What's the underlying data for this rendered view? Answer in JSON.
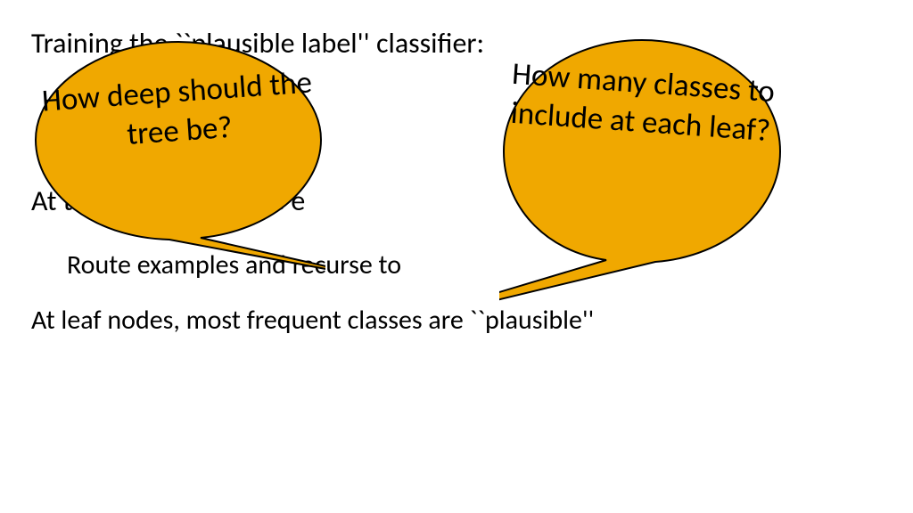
{
  "slide": {
    "lines": {
      "l1": "Training the ``plausible label'' classifier:",
      "l2": "At training time, solve e",
      "l3": "Route examples and recurse to",
      "l4": "At leaf nodes, most frequent classes are ``plausible''"
    }
  },
  "callouts": {
    "c1": "How deep should the tree be?",
    "c2": "How many classes to include at each leaf?"
  },
  "colors": {
    "bubble_fill": "#f0a800",
    "bubble_stroke": "#000000"
  }
}
